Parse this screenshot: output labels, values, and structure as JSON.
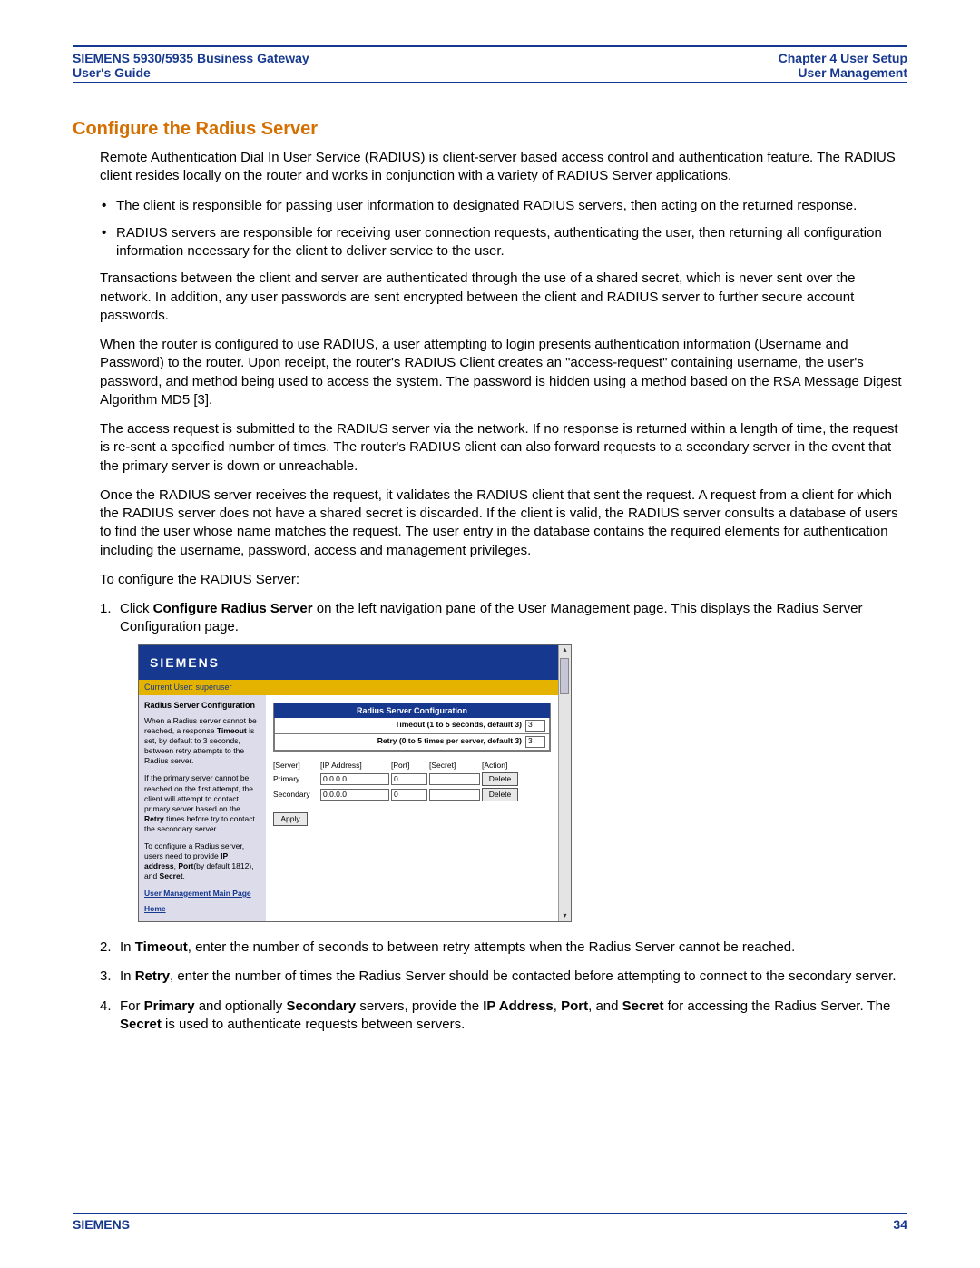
{
  "header": {
    "left_line1": "SIEMENS 5930/5935 Business Gateway",
    "left_line2": "User's Guide",
    "right_line1": "Chapter 4  User Setup",
    "right_line2": "User Management"
  },
  "section_title": "Configure the Radius Server",
  "intro": "Remote Authentication Dial In User Service (RADIUS) is client-server based access control and authentication feature. The RADIUS client resides locally on the router and works in conjunction with a variety of RADIUS Server applications.",
  "bullets": [
    "The client is responsible for passing user information to designated RADIUS servers, then acting on the returned response.",
    "RADIUS servers are responsible for receiving user connection requests, authenticating the user, then returning all configuration information necessary for the client to deliver service to the user."
  ],
  "paras": [
    "Transactions between the client and server are authenticated through the use of a shared secret, which is never sent over the network. In addition, any user passwords are sent encrypted between the client and RADIUS server to further secure account passwords.",
    "When the router is configured to use RADIUS, a user attempting to login presents authentication information (Username and Password) to the router. Upon receipt, the router's RADIUS Client creates an \"access-request\" containing username, the user's password, and method being used to access the system. The password is hidden using a method based on the RSA Message Digest Algorithm MD5 [3].",
    "The access request is submitted to the RADIUS server via the network. If no response is returned within a length of time, the request is re-sent a specified number of times. The router's RADIUS client can also forward requests to a secondary server in the event that the primary server is down or unreachable.",
    "Once the RADIUS server receives the request, it validates the RADIUS client that sent the request. A request from a client for which the RADIUS server does not have a shared secret is discarded. If the client is valid, the RADIUS server consults a database of users to find the user whose name matches the request. The user entry in the database contains the required elements for authentication including the username, password, access and management privileges.",
    "To configure the RADIUS Server:"
  ],
  "step1": {
    "prefix": "Click ",
    "bold": "Configure Radius Server",
    "suffix": " on the left navigation pane of the User Management page. This displays the Radius Server Configuration page."
  },
  "mock": {
    "brand": "SIEMENS",
    "current_user": "Current User: superuser",
    "side_title": "Radius Server Configuration",
    "side_p1_a": "When a Radius server cannot be reached, a response ",
    "side_p1_b": "Timeout",
    "side_p1_c": " is set, by default to 3 seconds, between retry attempts to the Radius server.",
    "side_p2_a": "If the primary server cannot be reached on the first attempt, the client will attempt to contact primary server based on the ",
    "side_p2_b": "Retry",
    "side_p2_c": " times before try to contact the secondary server.",
    "side_p3_a": "To configure a Radius server, users need to provide ",
    "side_p3_b": "IP address",
    "side_p3_c": ", ",
    "side_p3_d": "Port",
    "side_p3_e": "(by default 1812), and ",
    "side_p3_f": "Secret",
    "side_p3_g": ".",
    "link1": "User Management Main Page",
    "link2": "Home",
    "cfg_title": "Radius Server Configuration",
    "timeout_label": "Timeout (1 to 5 seconds, default 3)",
    "timeout_value": "3",
    "retry_label": "Retry (0 to 5 times per server, default 3)",
    "retry_value": "3",
    "cols": {
      "server": "[Server]",
      "ip": "[IP Address]",
      "port": "[Port]",
      "secret": "[Secret]",
      "action": "[Action]"
    },
    "rows": [
      {
        "server": "Primary",
        "ip": "0.0.0.0",
        "port": "0",
        "secret": "",
        "action": "Delete"
      },
      {
        "server": "Secondary",
        "ip": "0.0.0.0",
        "port": "0",
        "secret": "",
        "action": "Delete"
      }
    ],
    "apply": "Apply"
  },
  "step2": {
    "prefix": "In ",
    "bold": "Timeout",
    "suffix": ", enter the number of seconds to between retry attempts when the Radius Server cannot be reached."
  },
  "step3": {
    "prefix": "In ",
    "bold": "Retry",
    "suffix": ", enter the number of times the Radius Server should be contacted before attempting to connect to the secondary server."
  },
  "step4": {
    "t1": "For ",
    "b1": "Primary",
    "t2": " and optionally ",
    "b2": "Secondary",
    "t3": " servers, provide the ",
    "b3": "IP Address",
    "t4": ", ",
    "b4": "Port",
    "t5": ", and ",
    "b5": "Secret",
    "t6": " for accessing the Radius Server. The ",
    "b6": "Secret",
    "t7": " is used to authenticate requests between servers."
  },
  "footer": {
    "brand": "SIEMENS",
    "page": "34"
  }
}
